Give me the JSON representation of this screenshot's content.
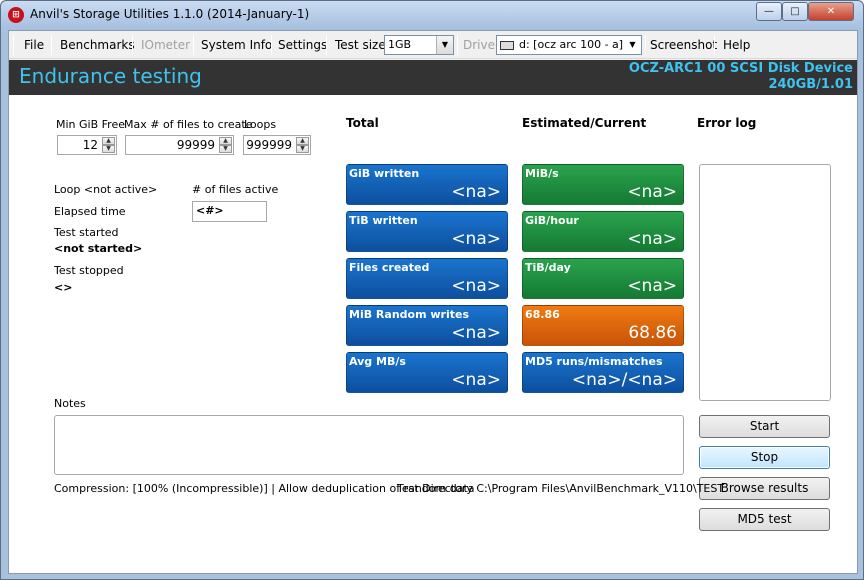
{
  "window": {
    "title": "Anvil's Storage Utilities 1.1.0 (2014-January-1)",
    "min_glyph": "—",
    "max_glyph": "□",
    "close_glyph": "✕"
  },
  "menu": {
    "file": "File",
    "benchmarks": "Benchmarks",
    "iometer": "IOmeter",
    "system_info": "System Info",
    "settings": "Settings",
    "test_size_label": "Test size",
    "test_size_value": "1GB",
    "drive_label": "Drive",
    "drive_value": "d: [ocz arc 100 - a]",
    "screenshot": "Screenshot",
    "help": "Help"
  },
  "header": {
    "title": "Endurance testing",
    "device": "OCZ-ARC1 00 SCSI Disk Device",
    "capacity": "240GB/1.01"
  },
  "params": {
    "min_gib_free_label": "Min GiB Free",
    "min_gib_free_value": "12",
    "max_files_label": "Max # of files to create",
    "max_files_value": "99999",
    "loops_label": "Loops",
    "loops_value": "999999"
  },
  "status_info": {
    "loop_label": "Loop <not active>",
    "files_active_label": "# of files active",
    "files_active_value": "<#>",
    "elapsed_label": "Elapsed time",
    "test_started_label": "Test started",
    "test_started_value": "<not started>",
    "test_stopped_label": "Test stopped",
    "test_stopped_value": "<>"
  },
  "sections": {
    "total": "Total",
    "estimated": "Estimated/Current",
    "error_log": "Error log",
    "notes": "Notes"
  },
  "tiles_total": [
    {
      "label": "GiB written",
      "value": "<na>"
    },
    {
      "label": "TiB written",
      "value": "<na>"
    },
    {
      "label": "Files created",
      "value": "<na>"
    },
    {
      "label": "MiB Random writes",
      "value": "<na>"
    },
    {
      "label": "Avg MB/s",
      "value": "<na>"
    }
  ],
  "tiles_estimated": [
    {
      "label": "MiB/s",
      "value": "<na>"
    },
    {
      "label": "GiB/hour",
      "value": "<na>"
    },
    {
      "label": "TiB/day",
      "value": "<na>"
    },
    {
      "label": "68.86",
      "value": "68.86"
    },
    {
      "label": "MD5 runs/mismatches",
      "value": "<na>/<na>"
    }
  ],
  "buttons": {
    "start": "Start",
    "stop": "Stop",
    "browse": "Browse results",
    "md5": "MD5 test"
  },
  "statusbar": {
    "compression": "Compression: [100% (Incompressible)] | Allow deduplication of random data",
    "test_dir": "Test Directory C:\\Program Files\\AnvilBenchmark_V110\\TEST"
  },
  "colors": {
    "accent": "#3fc3ee",
    "tile_blue": "#1565c0",
    "tile_green": "#1e8c3e",
    "tile_orange": "#e0650c"
  }
}
